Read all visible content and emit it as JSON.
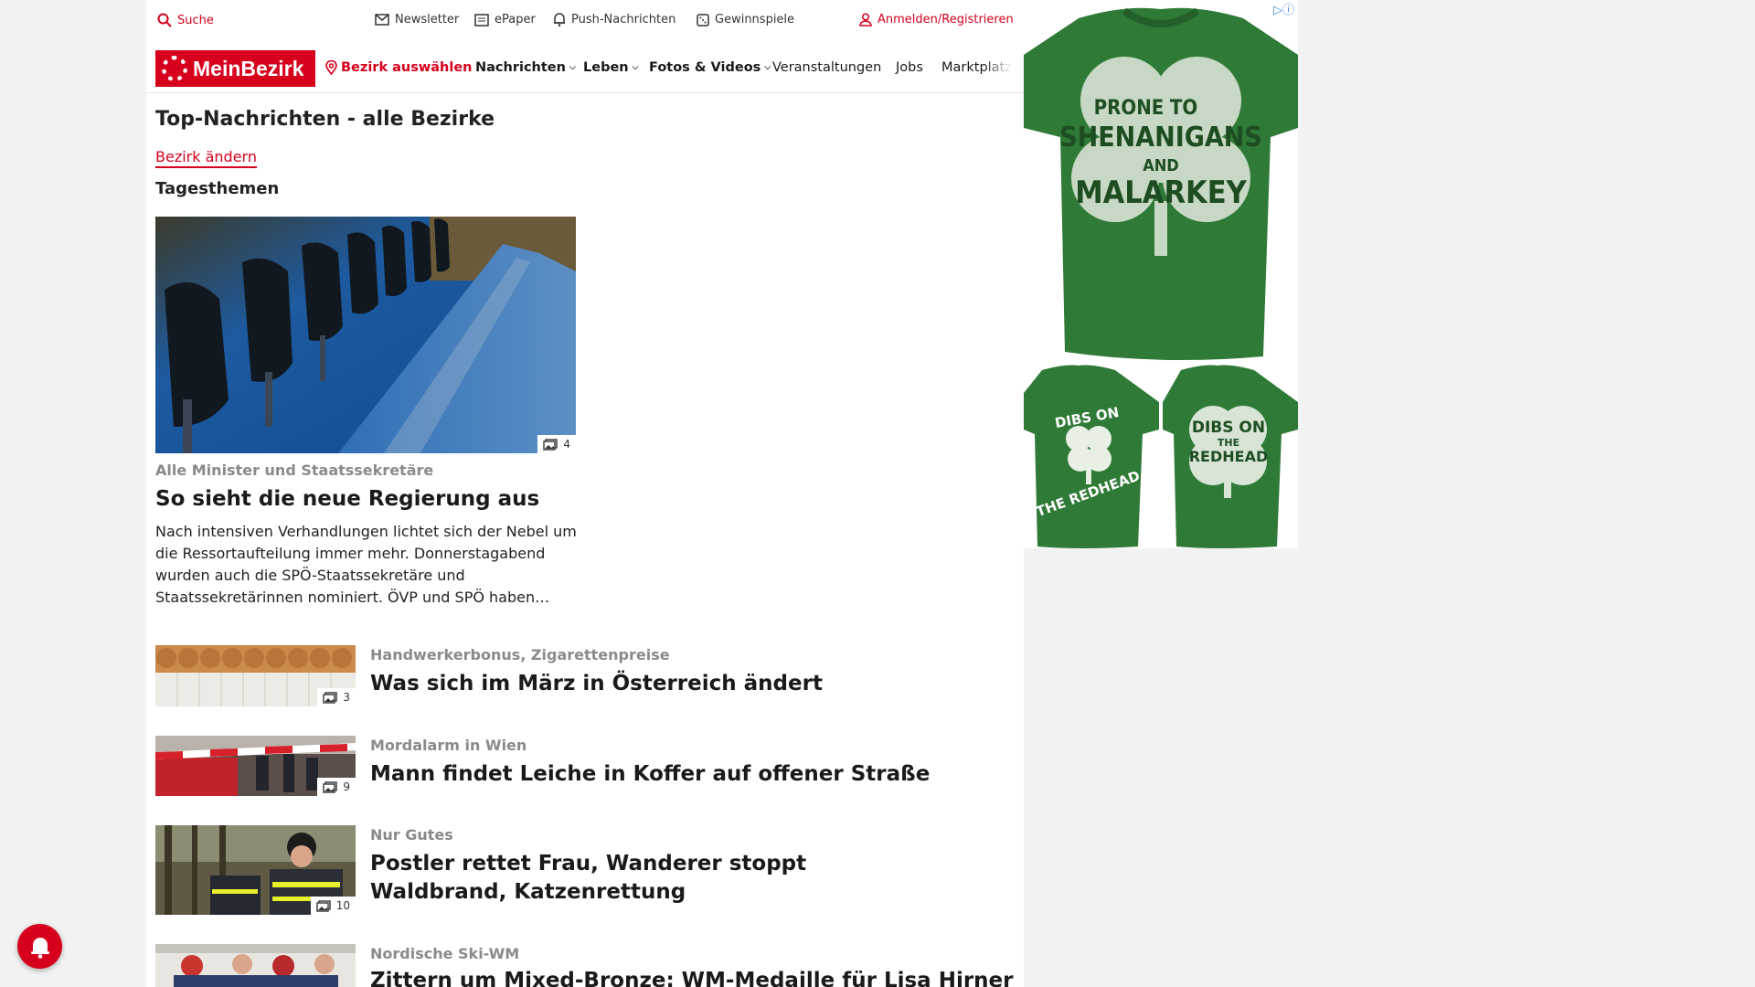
{
  "topbar": {
    "search": "Suche",
    "newsletter": "Newsletter",
    "epaper": "ePaper",
    "push": "Push-Nachrichten",
    "gewinnspiele": "Gewinnspiele",
    "login": "Anmelden/Registrieren",
    "in_logo": "in"
  },
  "nav": {
    "logo": "MeinBezirk",
    "bezirk": "Bezirk auswählen",
    "items": [
      "Nachrichten",
      "Leben",
      "Fotos & Videos",
      "Veranstaltungen",
      "Jobs",
      "Marktplatz"
    ]
  },
  "main": {
    "section_title": "Top-Nachrichten - alle Bezirke",
    "change_link": "Bezirk ändern",
    "subsection": "Tagesthemen",
    "hero": {
      "image_count": "4",
      "kicker": "Alle Minister und Staatssekretäre",
      "headline": "So sieht die neue Regierung aus",
      "teaser": "Nach intensiven Verhandlungen lichtet sich der Nebel um die Ressortaufteilung immer mehr. Donnerstagabend wurden auch die SPÖ-Staatssekretäre und Staatssekretärinnen nominiert. ÖVP und SPÖ haben…"
    },
    "articles": [
      {
        "kicker": "Handwerkerbonus, Zigarettenpreise",
        "headline": "Was sich im März in Österreich ändert",
        "image_count": "3"
      },
      {
        "kicker": "Mordalarm in Wien",
        "headline": "Mann findet Leiche in Koffer auf offener Straße",
        "image_count": "9"
      },
      {
        "kicker": "Nur Gutes",
        "headline": "Postler rettet Frau, Wanderer stoppt Waldbrand, Katzenrettung",
        "image_count": "10"
      },
      {
        "kicker": "Nordische Ski-WM",
        "headline": "Zittern um Mixed-Bronze: WM-Medaille für Lisa Hirner"
      }
    ]
  },
  "ad": {
    "shirt1_lines": [
      "PRONE",
      "TO",
      "SHENANIGANS",
      "AND",
      "MALARKEY"
    ],
    "shirt2_lines": [
      "DIBS ON",
      "THE REDHEAD"
    ],
    "shirt3_lines": [
      "DIBS ON",
      "THE",
      "REDHEAD"
    ],
    "info_icon": "ad-choices-icon"
  },
  "colors": {
    "brand": "#d6001c",
    "shirt_green": "#2f7a36"
  }
}
